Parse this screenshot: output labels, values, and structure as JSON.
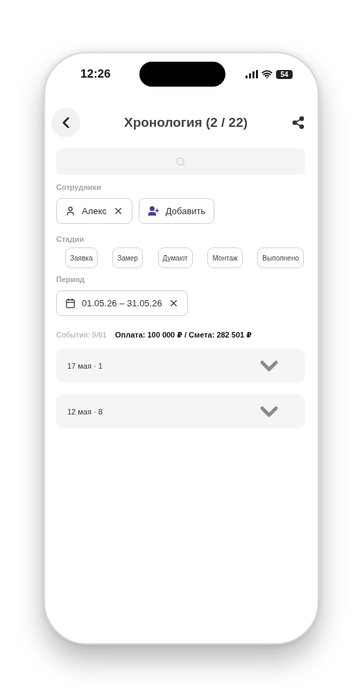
{
  "status_bar": {
    "time": "12:26",
    "battery": "54"
  },
  "header": {
    "title": "Хронология (2 / 22)"
  },
  "employees": {
    "label": "Сотрудники",
    "chips": [
      {
        "kind": "person",
        "label": "Алекс"
      },
      {
        "kind": "add",
        "label": "Добавить"
      }
    ]
  },
  "stages": {
    "label": "Стадии",
    "items": [
      {
        "label": "Заявка"
      },
      {
        "label": "Замер"
      },
      {
        "label": "Думают"
      },
      {
        "label": "Монтаж"
      },
      {
        "label": "Выполнено"
      }
    ]
  },
  "period": {
    "label": "Период",
    "value": "01.05.26 – 31.05.26"
  },
  "summary": {
    "events": "События: 9/61",
    "totals": "Оплата: 100 000 ₽ / Смета: 282 501 ₽"
  },
  "groups": [
    {
      "label": "17 мая · 1",
      "expanded": false
    },
    {
      "label": "12 мая · 8",
      "expanded": false
    }
  ]
}
